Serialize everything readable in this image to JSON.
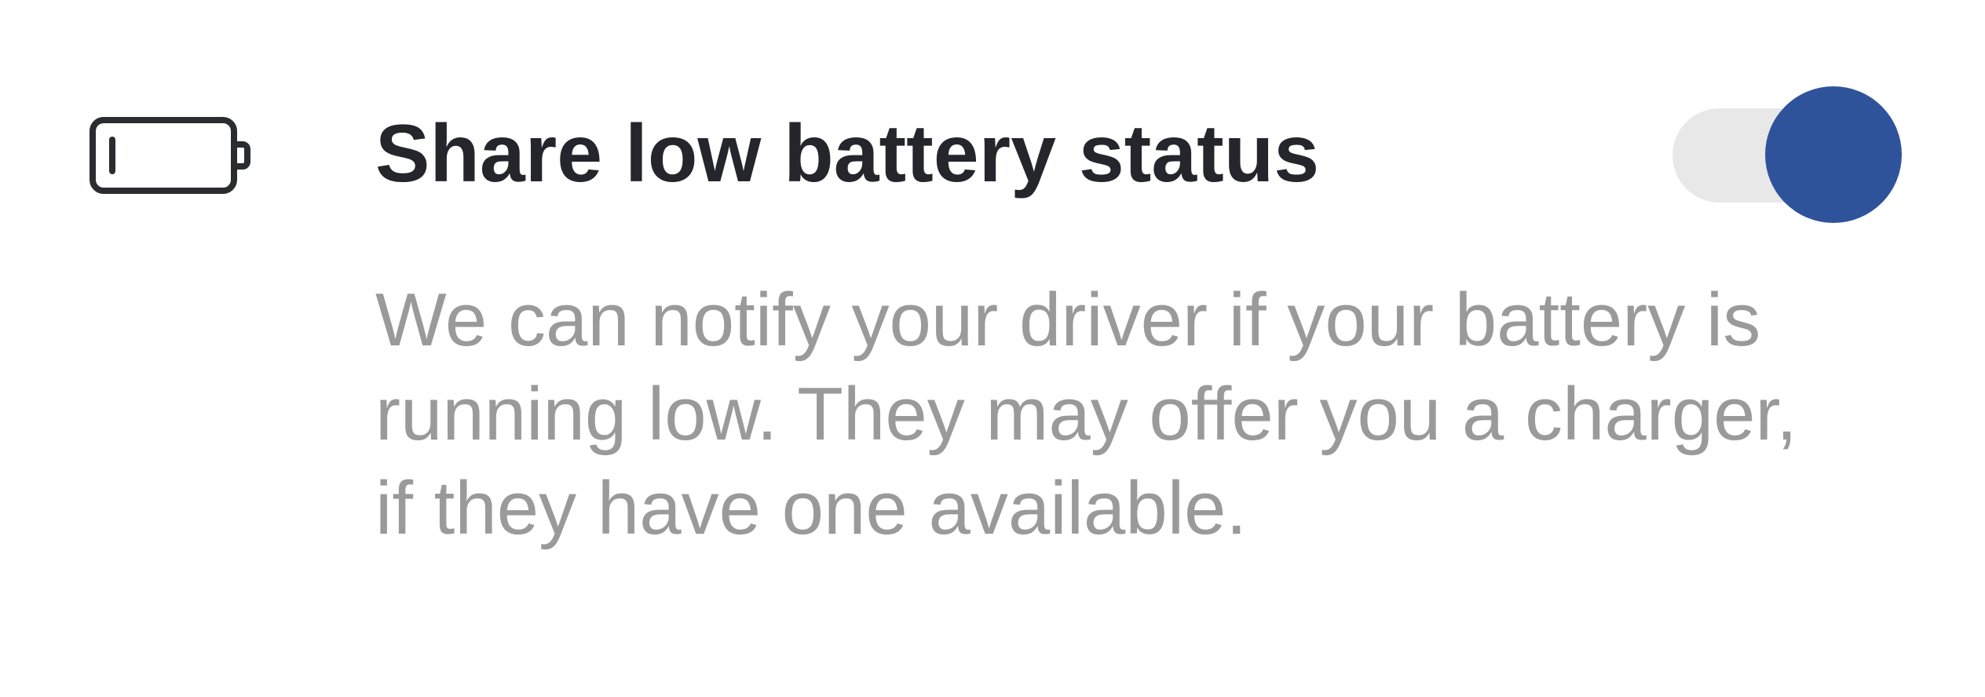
{
  "setting": {
    "icon": "battery-low-icon",
    "title": "Share low battery status",
    "description": "We can notify your driver if your battery is running low. They may offer you a charger, if they have one available.",
    "toggle": {
      "on": true,
      "accent_color": "#2f539b",
      "track_color": "#e8e8e8"
    }
  }
}
